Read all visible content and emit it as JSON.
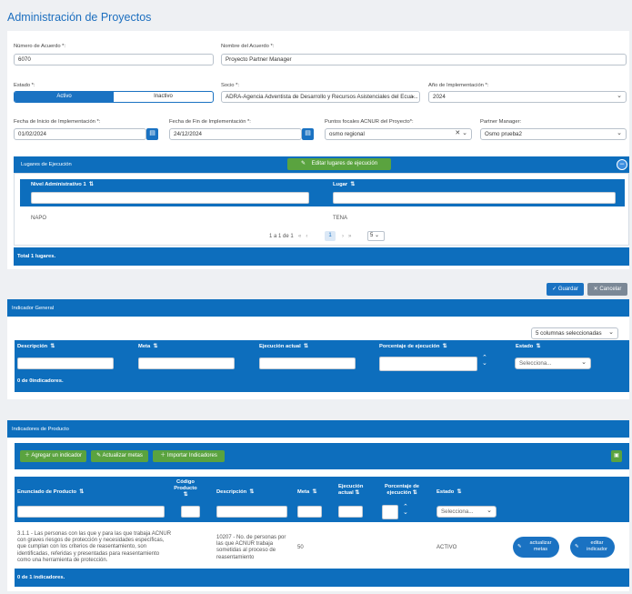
{
  "page": {
    "title": "Administración de Proyectos"
  },
  "form": {
    "numero_label": "Número de Acuerdo *:",
    "numero_value": "6070",
    "nombre_label": "Nombre del Acuerdo *:",
    "nombre_value": "Proyecto Partner Manager",
    "estado_label": "Estado *:",
    "estado_on": "Activo",
    "estado_off": "Inactivo",
    "socio_label": "Socio *:",
    "socio_value": "ADRA-Agencia Adventista de Desarrollo y Recursos Asistenciales del Ecua...",
    "anio_label": "Año de Implementación *:",
    "anio_value": "2024",
    "fecha_inicio_label": "Fecha de Inicio de Implementación *:",
    "fecha_inicio_value": "01/02/2024",
    "fecha_fin_label": "Fecha de Fin de Implementación *:",
    "fecha_fin_value": "24/12/2024",
    "puntos_label": "Puntos focales ACNUR del Proyecto*:",
    "puntos_value": "osmo regional",
    "partner_label": "Partner Manager:",
    "partner_value": "Osmo prueba2"
  },
  "lugares": {
    "header": "Lugares de Ejecución",
    "edit_button": "Editar lugares de ejecución",
    "col1": "Nivel Administrativo 1",
    "col2": "Lugar",
    "rows": [
      {
        "nivel": "NAPO",
        "lugar": "TENA"
      }
    ],
    "pager_text": "1 a 1 de 1",
    "page": "1",
    "per_page": "5",
    "total": "Total 1 lugares."
  },
  "actions": {
    "guardar": "Guardar",
    "cancelar": "Cancelar"
  },
  "indicador_general": {
    "header": "Indicador General",
    "columns_select": "5 columnas seleccionadas",
    "cols": [
      "Descripción",
      "Meta",
      "Ejecución actual",
      "Porcentaje de ejecución",
      "Estado"
    ],
    "estado_placeholder": "Selecciona...",
    "footer": "0 de 0indicadores."
  },
  "indicadores_producto": {
    "header": "Indicadores de Producto",
    "btn_agregar": "Agregar un indicador",
    "btn_actualizar": "Actualizar metas",
    "btn_importar": "Importar Indicadores",
    "cols": [
      "Enunciado de Producto",
      "Código Producto",
      "Descripción",
      "Meta",
      "Ejecución actual",
      "Porcentaje de ejecución",
      "Estado"
    ],
    "estado_placeholder": "Selecciona...",
    "row": {
      "enunciado": "3.1.1 - Las personas con las que y para las que trabaja ACNUR con graves riesgos de protección y necesidades específicas, que cumplan con los criterios de reasentamiento, son identificadas, referidas y presentadas para reasentamiento como una herramienta de protección.",
      "descripcion": "10207 - No. de personas por las que ACNUR trabaja sometidas al proceso de reasentamiento",
      "meta": "50",
      "estado": "ACTIVO",
      "btn_actualizar": "actualizar metas",
      "btn_editar": "editar indicador"
    },
    "footer": "0 de 1 indicadores."
  },
  "colors": {
    "accent": "#1a72c2",
    "bar": "#0d6ebd",
    "green": "#5aa33f",
    "title": "#1d6fbf"
  }
}
